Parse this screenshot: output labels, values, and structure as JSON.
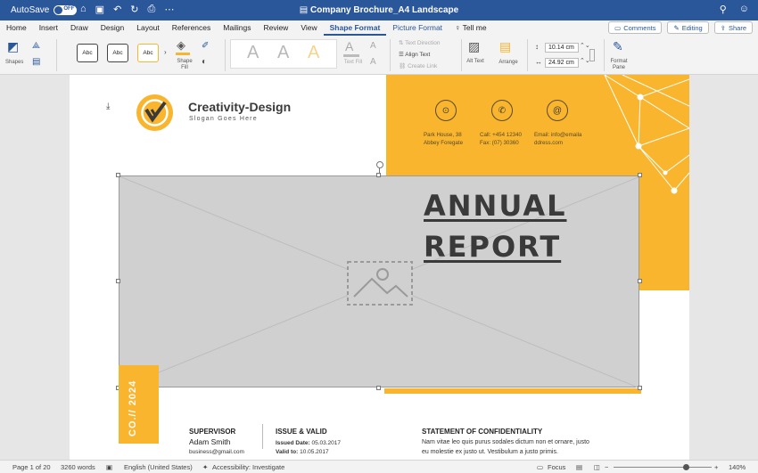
{
  "titlebar": {
    "autosave_label": "AutoSave",
    "autosave_state": "OFF",
    "doc_title": "Company Brochure_A4 Landscape"
  },
  "tabs": [
    "Home",
    "Insert",
    "Draw",
    "Design",
    "Layout",
    "References",
    "Mailings",
    "Review",
    "View",
    "Shape Format",
    "Picture Format",
    "Tell me"
  ],
  "active_tab": "Shape Format",
  "tabs_right": {
    "comments": "Comments",
    "editing": "Editing",
    "share": "Share"
  },
  "ribbon": {
    "shapes_label": "Shapes",
    "style_label": "Abc",
    "shape_fill": "Shape Fill",
    "wordart_letter": "A",
    "text_fill": "Text Fill",
    "text_direction": "Text Direction",
    "align_text": "Align Text",
    "create_link": "Create Link",
    "alt_text": "Alt Text",
    "arrange": "Arrange",
    "height": "10.14 cm",
    "width": "24.92 cm",
    "format_pane": "Format Pane"
  },
  "document": {
    "brand": "Creativity-Design",
    "slogan": "Slogan Goes Here",
    "address": [
      "Park House, 38",
      "Abbey Foregate"
    ],
    "phone": [
      "Call: +454 12340",
      "Fax: (07) 30360"
    ],
    "email": [
      "Email: info@emaila",
      "ddress.com"
    ],
    "headline_1": "ANNUAL",
    "headline_2": "REPORT",
    "tag": "CO.// 2024",
    "supervisor_h": "SUPERVISOR",
    "supervisor_name": "Adam Smith",
    "supervisor_email": "business@gmail.com",
    "issue_h": "ISSUE & VALID",
    "issued_date_label": "Issued Date:",
    "issued_date": "05.03.2017",
    "valid_label": "Valid to:",
    "valid_date": "10.05.2017",
    "confidential_h": "STATEMENT OF CONFIDENTIALITY",
    "confidential_t1": "Nam vitae leo quis purus sodales dictum non et ornare, justo",
    "confidential_t2": "eu molestie ex justo ut. Vestibulum a justo primis."
  },
  "status": {
    "page": "Page 1 of 20",
    "words": "3260 words",
    "language": "English (United States)",
    "accessibility": "Accessibility: Investigate",
    "focus": "Focus",
    "zoom": "140%"
  },
  "colors": {
    "brand_blue": "#2a569a",
    "accent_orange": "#f9b52d"
  }
}
